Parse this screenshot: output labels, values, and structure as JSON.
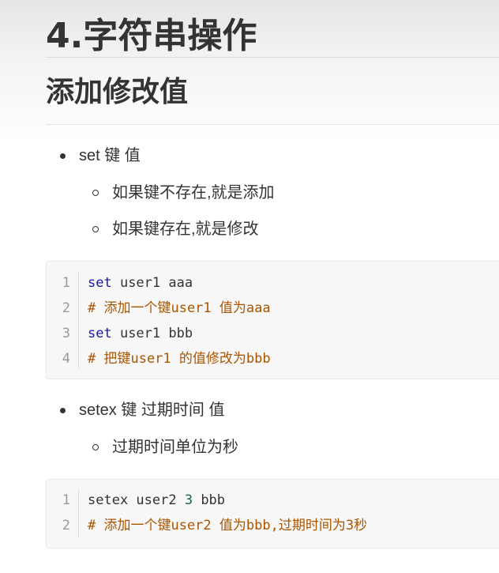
{
  "heading1": "4.字符串操作",
  "heading2": "添加修改值",
  "section1": {
    "bullet": "set 键 值",
    "subs": [
      "如果键不存在,就是添加",
      "如果键存在,就是修改"
    ]
  },
  "code1": {
    "lines": [
      {
        "n": "1",
        "kw": "set",
        "rest": " user1 aaa"
      },
      {
        "n": "2",
        "comment": "# 添加一个键user1 值为aaa"
      },
      {
        "n": "3",
        "kw": "set",
        "rest": " user1 bbb"
      },
      {
        "n": "4",
        "comment": "# 把键user1 的值修改为bbb"
      }
    ]
  },
  "section2": {
    "bullet": "setex 键 过期时间 值",
    "subs": [
      "过期时间单位为秒"
    ]
  },
  "code2": {
    "lines": [
      {
        "n": "1",
        "pre": "setex user2 ",
        "num": "3",
        "post": " bbb"
      },
      {
        "n": "2",
        "comment": "# 添加一个键user2 值为bbb,过期时间为3秒"
      }
    ]
  }
}
